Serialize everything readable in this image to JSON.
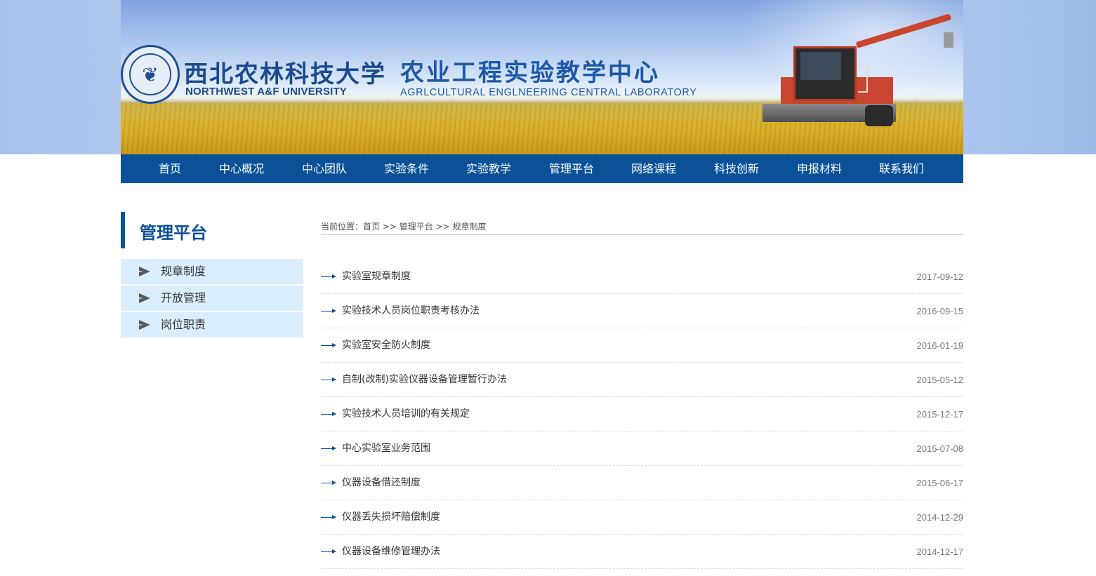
{
  "header": {
    "university_cn": "西北农林科技大学",
    "university_en": "NORTHWEST A&F UNIVERSITY",
    "center_cn": "农业工程实验教学中心",
    "center_en": "AGRLCULTURAL ENGLNEERING CENTRAL LABORATORY",
    "logo_icon": "university-seal-icon",
    "banner_image": "wheat-field-harvester"
  },
  "nav": {
    "items": [
      {
        "label": "首页"
      },
      {
        "label": "中心概况"
      },
      {
        "label": "中心团队"
      },
      {
        "label": "实验条件"
      },
      {
        "label": "实验教学"
      },
      {
        "label": "管理平台"
      },
      {
        "label": "网络课程"
      },
      {
        "label": "科技创新"
      },
      {
        "label": "申报材料"
      },
      {
        "label": "联系我们"
      }
    ]
  },
  "sidebar": {
    "title": "管理平台",
    "items": [
      {
        "label": "规章制度",
        "icon": "arrow-right-icon"
      },
      {
        "label": "开放管理",
        "icon": "arrow-right-icon"
      },
      {
        "label": "岗位职责",
        "icon": "arrow-right-icon"
      }
    ]
  },
  "breadcrumb": {
    "prefix": "当前位置：",
    "home": "首页",
    "sep1": " >> ",
    "section": "管理平台",
    "sep2": " >> ",
    "current": "规章制度"
  },
  "articles": [
    {
      "title": "实验室规章制度",
      "date": "2017-09-12"
    },
    {
      "title": "实验技术人员岗位职责考核办法",
      "date": "2016-09-15"
    },
    {
      "title": "实验室安全防火制度",
      "date": "2016-01-19"
    },
    {
      "title": "自制(改制)实验仪器设备管理暂行办法",
      "date": "2015-05-12"
    },
    {
      "title": "实验技术人员培训的有关规定",
      "date": "2015-12-17"
    },
    {
      "title": "中心实验室业务范围",
      "date": "2015-07-08"
    },
    {
      "title": "仪器设备借还制度",
      "date": "2015-06-17"
    },
    {
      "title": "仪器丢失损坏赔偿制度",
      "date": "2014-12-29"
    },
    {
      "title": "仪器设备维修管理办法",
      "date": "2014-12-17"
    }
  ],
  "colors": {
    "nav_bg": "#0a5198",
    "sidebar_item_bg": "#dbeefe",
    "header_text": "#1b4a8c",
    "accent_blue": "#0a4f95"
  }
}
